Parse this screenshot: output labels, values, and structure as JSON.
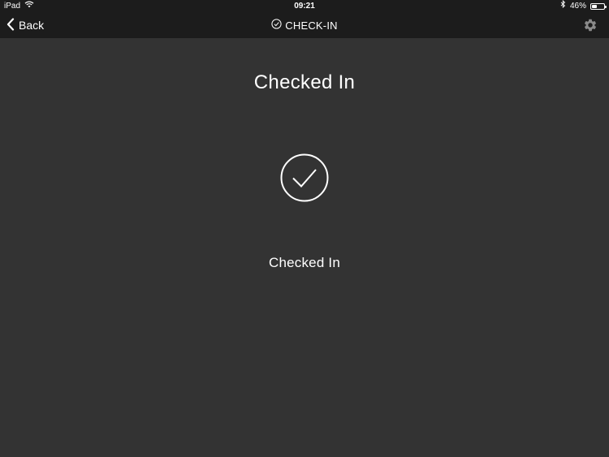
{
  "status_bar": {
    "device": "iPad",
    "time": "09:21",
    "battery_percent_text": "46%",
    "battery_level": 0.46
  },
  "nav": {
    "back_label": "Back",
    "title": "CHECK-IN"
  },
  "main": {
    "heading": "Checked In",
    "status_label": "Checked In"
  },
  "icons": {
    "wifi": "wifi-icon",
    "bluetooth": "bluetooth-icon",
    "battery": "battery-icon",
    "back": "chevron-left-icon",
    "title": "check-circle-icon",
    "settings": "gear-icon",
    "status": "check-circle-icon"
  },
  "colors": {
    "background": "#333333",
    "bar": "#1c1c1c",
    "foreground": "#ffffff"
  }
}
